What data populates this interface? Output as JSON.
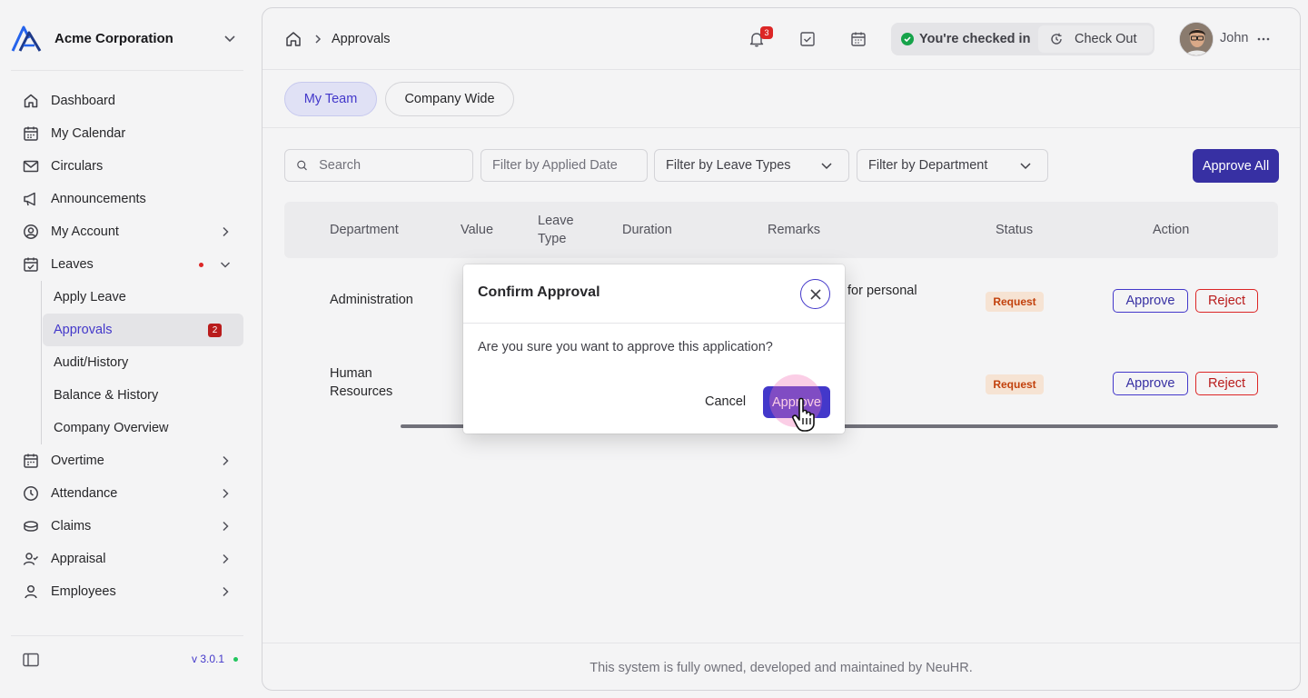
{
  "brand": {
    "name": "Acme Corporation"
  },
  "nav": {
    "items": [
      {
        "label": "Dashboard",
        "icon": "home-icon"
      },
      {
        "label": "My Calendar",
        "icon": "calendar-icon"
      },
      {
        "label": "Circulars",
        "icon": "mail-icon"
      },
      {
        "label": "Announcements",
        "icon": "megaphone-icon"
      },
      {
        "label": "My Account",
        "icon": "user-circle-icon"
      },
      {
        "label": "Leaves",
        "icon": "calendar-check-icon"
      }
    ],
    "leaves_sub": [
      {
        "label": "Apply Leave"
      },
      {
        "label": "Approvals",
        "badge": "2"
      },
      {
        "label": "Audit/History"
      },
      {
        "label": "Balance & History"
      },
      {
        "label": "Company Overview"
      }
    ],
    "items_after": [
      {
        "label": "Overtime",
        "icon": "calendar-grid-icon"
      },
      {
        "label": "Attendance",
        "icon": "clock-icon"
      },
      {
        "label": "Claims",
        "icon": "coins-icon"
      },
      {
        "label": "Appraisal",
        "icon": "user-check-icon"
      },
      {
        "label": "Employees",
        "icon": "user-icon"
      }
    ],
    "version": "v 3.0.1"
  },
  "topbar": {
    "breadcrumb_current": "Approvals",
    "notification_count": "3",
    "checkin_status": "You're checked in",
    "checkout_label": "Check Out",
    "user_name": "John"
  },
  "tabs": [
    {
      "label": "My Team"
    },
    {
      "label": "Company Wide"
    }
  ],
  "filters": {
    "search_placeholder": "Search",
    "applied_date_placeholder": "Filter by Applied Date",
    "leave_types_label": "Filter by Leave Types",
    "department_label": "Filter by Department",
    "approve_all_label": "Approve All"
  },
  "table": {
    "headers": {
      "department": "Department",
      "value": "Value",
      "leave_type_1": "Leave",
      "leave_type_2": "Type",
      "duration": "Duration",
      "remarks": "Remarks",
      "status": "Status",
      "action": "Action"
    },
    "rows": [
      {
        "department": "Administration",
        "remarks": "for personal",
        "status": "Request",
        "approve": "Approve",
        "reject": "Reject"
      },
      {
        "department_1": "Human",
        "department_2": "Resources",
        "status": "Request",
        "approve": "Approve",
        "reject": "Reject"
      }
    ]
  },
  "footer": {
    "text": "This system is fully owned, developed and maintained by NeuHR."
  },
  "modal": {
    "title": "Confirm Approval",
    "body": "Are you sure you want to approve this application?",
    "cancel_label": "Cancel",
    "approve_label": "Approve"
  },
  "colors": {
    "accent": "#4338ca",
    "danger": "#dc2626",
    "success": "#16a34a",
    "request_tag": "#c2410c"
  }
}
